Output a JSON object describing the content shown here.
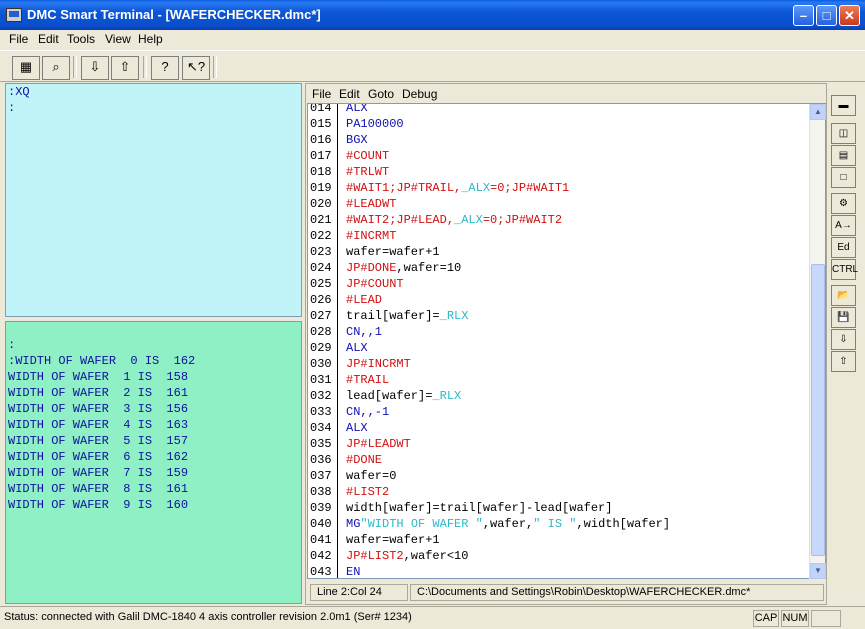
{
  "window": {
    "title": "DMC Smart Terminal - [WAFERCHECKER.dmc*]"
  },
  "menubar": [
    {
      "label": "File"
    },
    {
      "label": "Edit"
    },
    {
      "label": "Tools"
    },
    {
      "label": "View"
    },
    {
      "label": "Help"
    }
  ],
  "toolbar": {
    "buttons": [
      {
        "name": "connect-controller-icon",
        "glyph": "▦"
      },
      {
        "name": "find-controller-icon",
        "glyph": "⌕"
      },
      {
        "name": "download-icon",
        "glyph": "⇩"
      },
      {
        "name": "upload-icon",
        "glyph": "⇧"
      },
      {
        "name": "help-icon",
        "glyph": "?"
      },
      {
        "name": "context-help-icon",
        "glyph": "↖?"
      }
    ]
  },
  "terminal": {
    "top_lines": [
      ":XQ",
      ":"
    ],
    "bottom_lines": [
      ":",
      ":WIDTH OF WAFER  0 IS  162",
      "WIDTH OF WAFER  1 IS  158",
      "WIDTH OF WAFER  2 IS  161",
      "WIDTH OF WAFER  3 IS  156",
      "WIDTH OF WAFER  4 IS  163",
      "WIDTH OF WAFER  5 IS  157",
      "WIDTH OF WAFER  6 IS  162",
      "WIDTH OF WAFER  7 IS  159",
      "WIDTH OF WAFER  8 IS  161",
      "WIDTH OF WAFER  9 IS  160"
    ]
  },
  "editor": {
    "menu": [
      {
        "label": "File"
      },
      {
        "label": "Edit"
      },
      {
        "label": "Goto"
      },
      {
        "label": "Debug"
      }
    ],
    "lines": [
      {
        "num": "014",
        "segs": [
          {
            "t": "ALX",
            "c": "st"
          }
        ]
      },
      {
        "num": "015",
        "segs": [
          {
            "t": "PA100000",
            "c": "st"
          }
        ]
      },
      {
        "num": "016",
        "segs": [
          {
            "t": "BGX",
            "c": "st"
          }
        ]
      },
      {
        "num": "017",
        "segs": [
          {
            "t": "#COUNT",
            "c": "kw"
          }
        ]
      },
      {
        "num": "018",
        "segs": [
          {
            "t": "#TRLWT",
            "c": "kw"
          }
        ]
      },
      {
        "num": "019",
        "segs": [
          {
            "t": "#WAIT1;JP#TRAIL,",
            "c": "kw"
          },
          {
            "t": "_ALX",
            "c": "sv"
          },
          {
            "t": "=0;JP#WAIT1",
            "c": "kw"
          }
        ]
      },
      {
        "num": "020",
        "segs": [
          {
            "t": "#LEADWT",
            "c": "kw"
          }
        ]
      },
      {
        "num": "021",
        "segs": [
          {
            "t": "#WAIT2;JP#LEAD,",
            "c": "kw"
          },
          {
            "t": "_ALX",
            "c": "sv"
          },
          {
            "t": "=0;JP#WAIT2",
            "c": "kw"
          }
        ]
      },
      {
        "num": "022",
        "segs": [
          {
            "t": "#INCRMT",
            "c": "kw"
          }
        ]
      },
      {
        "num": "023",
        "segs": [
          {
            "t": "wafer=wafer+1",
            "c": "pl"
          }
        ]
      },
      {
        "num": "024",
        "segs": [
          {
            "t": "JP#DONE",
            "c": "kw"
          },
          {
            "t": ",wafer=10",
            "c": "pl"
          }
        ]
      },
      {
        "num": "025",
        "segs": [
          {
            "t": "JP#COUNT",
            "c": "kw"
          }
        ]
      },
      {
        "num": "026",
        "segs": [
          {
            "t": "#LEAD",
            "c": "kw"
          }
        ]
      },
      {
        "num": "027",
        "segs": [
          {
            "t": "trail[wafer]=",
            "c": "pl"
          },
          {
            "t": "_RLX",
            "c": "sv"
          }
        ]
      },
      {
        "num": "028",
        "segs": [
          {
            "t": "CN,,1",
            "c": "st"
          }
        ]
      },
      {
        "num": "029",
        "segs": [
          {
            "t": "ALX",
            "c": "st"
          }
        ]
      },
      {
        "num": "030",
        "segs": [
          {
            "t": "JP#INCRMT",
            "c": "kw"
          }
        ]
      },
      {
        "num": "031",
        "segs": [
          {
            "t": "#TRAIL",
            "c": "kw"
          }
        ]
      },
      {
        "num": "032",
        "segs": [
          {
            "t": "lead[wafer]=",
            "c": "pl"
          },
          {
            "t": "_RLX",
            "c": "sv"
          }
        ]
      },
      {
        "num": "033",
        "segs": [
          {
            "t": "CN,,-1",
            "c": "st"
          }
        ]
      },
      {
        "num": "034",
        "segs": [
          {
            "t": "ALX",
            "c": "st"
          }
        ]
      },
      {
        "num": "035",
        "segs": [
          {
            "t": "JP#LEADWT",
            "c": "kw"
          }
        ]
      },
      {
        "num": "036",
        "segs": [
          {
            "t": "#DONE",
            "c": "kw"
          }
        ]
      },
      {
        "num": "037",
        "segs": [
          {
            "t": "wafer=0",
            "c": "pl"
          }
        ]
      },
      {
        "num": "038",
        "segs": [
          {
            "t": "#LIST2",
            "c": "kw"
          }
        ]
      },
      {
        "num": "039",
        "segs": [
          {
            "t": "width[wafer]=trail[wafer]-lead[wafer]",
            "c": "pl"
          }
        ]
      },
      {
        "num": "040",
        "segs": [
          {
            "t": "MG",
            "c": "st"
          },
          {
            "t": "\"WIDTH OF WAFER \"",
            "c": "sv"
          },
          {
            "t": ",wafer,",
            "c": "pl"
          },
          {
            "t": "\" IS \"",
            "c": "sv"
          },
          {
            "t": ",width[wafer]",
            "c": "pl"
          }
        ]
      },
      {
        "num": "041",
        "segs": [
          {
            "t": "wafer=wafer+1",
            "c": "pl"
          }
        ]
      },
      {
        "num": "042",
        "segs": [
          {
            "t": "JP#LIST2",
            "c": "kw"
          },
          {
            "t": ",wafer<10",
            "c": "pl"
          }
        ]
      },
      {
        "num": "043",
        "segs": [
          {
            "t": "EN",
            "c": "st"
          }
        ]
      }
    ],
    "status_position": "Line 2:Col 24",
    "status_path": "C:\\Documents and Settings\\Robin\\Desktop\\WAFERCHECKER.dmc*"
  },
  "right_toolbar": [
    {
      "name": "disabled-tool-icon",
      "glyph": "▬"
    },
    {
      "name": "layout-split-icon",
      "glyph": "◫"
    },
    {
      "name": "layout-horizontal-icon",
      "glyph": "▤"
    },
    {
      "name": "layout-single-icon",
      "glyph": "□"
    },
    {
      "name": "send-command-icon",
      "glyph": "⚙"
    },
    {
      "name": "command-arrow-icon",
      "glyph": "A→"
    },
    {
      "name": "editor-icon",
      "glyph": "Ed"
    },
    {
      "name": "ctrl-icon",
      "glyph": "CTRL"
    },
    {
      "name": "open-folder-icon",
      "glyph": "📂"
    },
    {
      "name": "save-disk-icon",
      "glyph": "💾"
    },
    {
      "name": "download-file-icon",
      "glyph": "⇩"
    },
    {
      "name": "upload-file-icon",
      "glyph": "⇧"
    }
  ],
  "statusbar": {
    "text": "Status: connected with Galil DMC-1840 4 axis controller revision 2.0m1 (Ser# 1234)",
    "cap": "CAP",
    "num": "NUM"
  }
}
